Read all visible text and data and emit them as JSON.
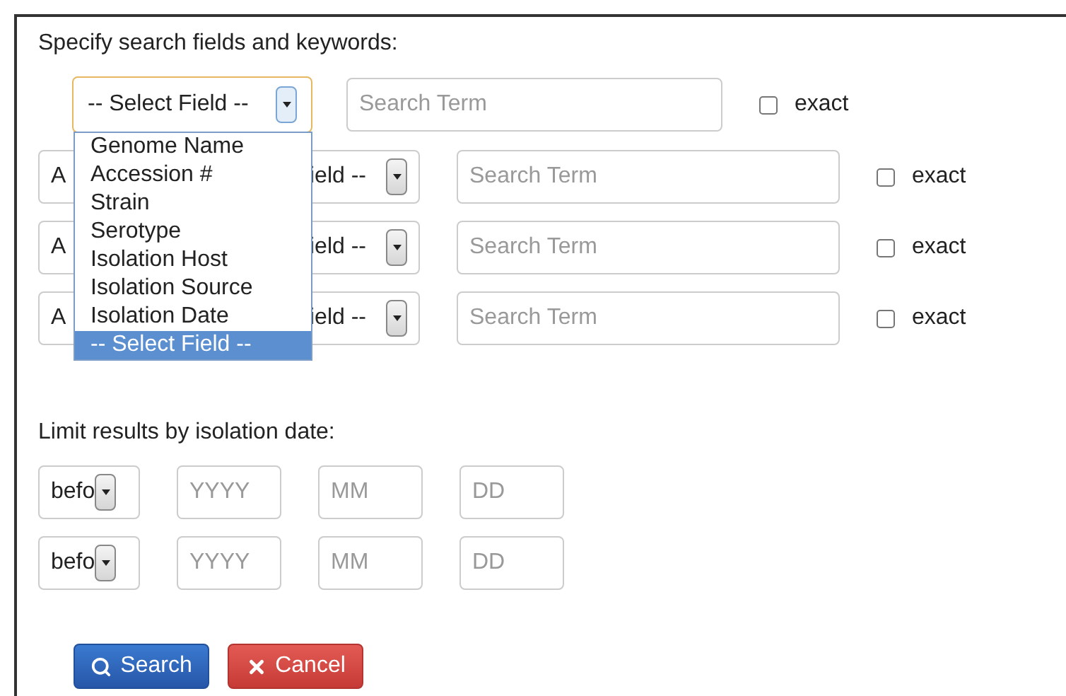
{
  "search_section": {
    "heading": "Specify search fields and keywords:"
  },
  "first_row": {
    "select": {
      "value": "-- Select Field --",
      "open": true
    },
    "search_term": {
      "placeholder": "Search Term"
    },
    "exact": {
      "label": "exact",
      "checked": false
    }
  },
  "dropdown_options": [
    {
      "label": "Genome Name",
      "selected": false
    },
    {
      "label": "Accession #",
      "selected": false
    },
    {
      "label": "Strain",
      "selected": false
    },
    {
      "label": "Serotype",
      "selected": false
    },
    {
      "label": "Isolation Host",
      "selected": false
    },
    {
      "label": "Isolation Source",
      "selected": false
    },
    {
      "label": "Isolation Date",
      "selected": false
    },
    {
      "label": "-- Select Field --",
      "selected": true
    }
  ],
  "rows": [
    {
      "select_visible_start": "A",
      "select_visible_end": "ield --",
      "search_term": {
        "placeholder": "Search Term"
      },
      "exact": {
        "label": "exact",
        "checked": false
      }
    },
    {
      "select_visible_start": "A",
      "select_visible_end": "ield --",
      "search_term": {
        "placeholder": "Search Term"
      },
      "exact": {
        "label": "exact",
        "checked": false
      }
    },
    {
      "select_visible_start": "A",
      "select_visible_end": "ield --",
      "search_term": {
        "placeholder": "Search Term"
      },
      "exact": {
        "label": "exact",
        "checked": false
      }
    }
  ],
  "date_section": {
    "heading": "Limit results by isolation date:",
    "rows": [
      {
        "comparator": "befo",
        "year": {
          "placeholder": "YYYY"
        },
        "month": {
          "placeholder": "MM"
        },
        "day": {
          "placeholder": "DD"
        }
      },
      {
        "comparator": "befo",
        "year": {
          "placeholder": "YYYY"
        },
        "month": {
          "placeholder": "MM"
        },
        "day": {
          "placeholder": "DD"
        }
      }
    ]
  },
  "buttons": [
    {
      "label": "Search",
      "kind": "search"
    },
    {
      "label": "Cancel",
      "kind": "cancel"
    }
  ]
}
